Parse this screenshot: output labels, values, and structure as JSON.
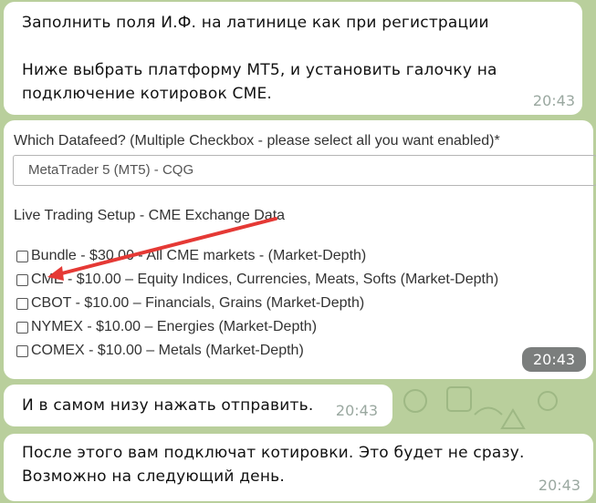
{
  "messages": [
    {
      "text": "Заполнить поля И.Ф. на латинице как при регистрации\n\nНиже выбрать платформу MT5, и установить галочку на подключение котировок CME.",
      "time": "20:43"
    },
    {
      "time": "20:43"
    },
    {
      "text": "И в самом низу нажать отправить.",
      "time": "20:43"
    },
    {
      "text": "После этого вам подключат котировки. Это будет не сразу. Возможно на следующий день.",
      "time": "20:43"
    }
  ],
  "form_screenshot": {
    "datafeed_label": "Which Datafeed? (Multiple Checkbox - please select all you want enabled)*",
    "datafeed_value": "MetaTrader 5 (MT5) - CQG",
    "live_setup_label": "Live Trading Setup - CME Exchange Data",
    "options": [
      {
        "label": "Bundle - $30.00 - All CME markets - (Market-Depth)",
        "checked": false
      },
      {
        "label": "CME - $10.00 – Equity Indices, Currencies, Meats, Softs (Market-Depth)",
        "checked": false
      },
      {
        "label": "CBOT - $10.00 – Financials, Grains (Market-Depth)",
        "checked": false
      },
      {
        "label": "NYMEX - $10.00 – Energies (Market-Depth)",
        "checked": false
      },
      {
        "label": "COMEX - $10.00 – Metals (Market-Depth)",
        "checked": false
      }
    ]
  },
  "colors": {
    "chat_background": "#b9cf9c",
    "arrow": "#e53935",
    "time_badge": "#7b7e7d"
  }
}
